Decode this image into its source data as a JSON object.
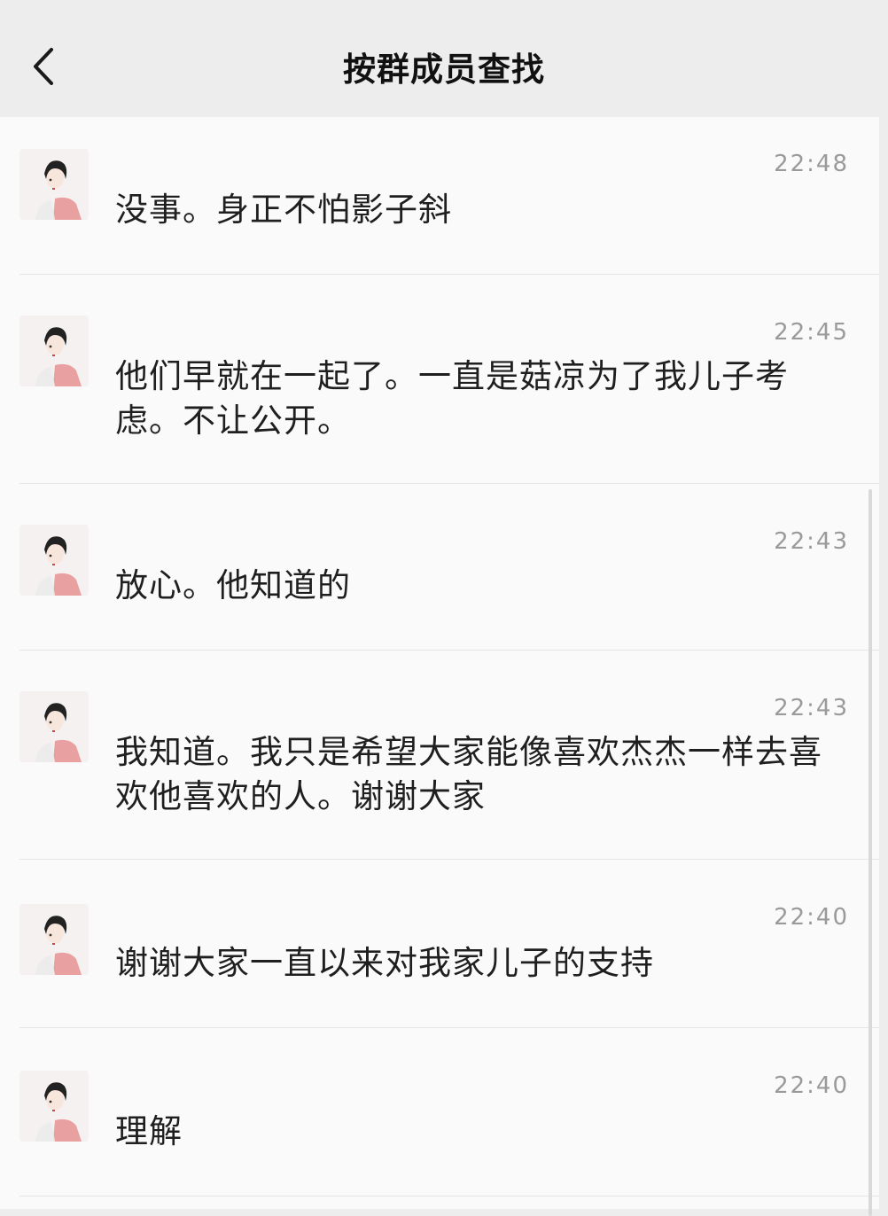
{
  "header": {
    "title": "按群成员查找"
  },
  "messages": [
    {
      "time": "22:48",
      "text": "没事。身正不怕影子斜"
    },
    {
      "time": "22:45",
      "text": "他们早就在一起了。一直是菇凉为了我儿子考虑。不让公开。"
    },
    {
      "time": "22:43",
      "text": "放心。他知道的"
    },
    {
      "time": "22:43",
      "text": "我知道。我只是希望大家能像喜欢杰杰一样去喜欢他喜欢的人。谢谢大家"
    },
    {
      "time": "22:40",
      "text": "谢谢大家一直以来对我家儿子的支持"
    },
    {
      "time": "22:40",
      "text": "理解"
    }
  ],
  "colors": {
    "header_bg": "#ededed",
    "list_bg": "#fafafa",
    "time": "#9a9a9a",
    "avatar_shirt": "#e8a0a0"
  },
  "icons": {
    "back": "chevron-left-icon",
    "avatar": "avatar-illustration"
  }
}
